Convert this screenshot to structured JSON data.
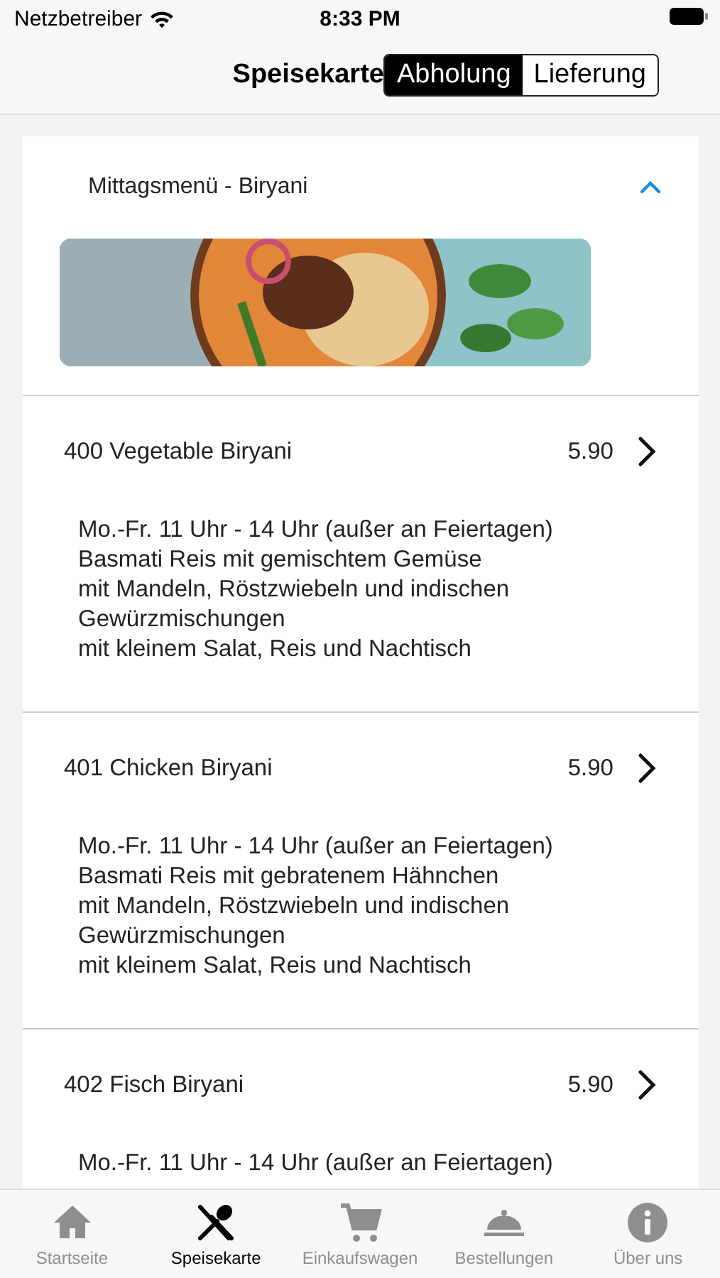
{
  "status_bar": {
    "carrier": "Netzbetreiber",
    "time": "8:33 PM"
  },
  "nav": {
    "title": "Speisekarte",
    "segments": [
      {
        "label": "Abholung",
        "selected": true
      },
      {
        "label": "Lieferung",
        "selected": false
      }
    ]
  },
  "section": {
    "title": "Mittagsmenü - Biryani",
    "expanded": true
  },
  "items": [
    {
      "name": "400 Vegetable Biryani",
      "price": "5.90",
      "description": "Mo.-Fr. 11 Uhr - 14 Uhr (außer an Feiertagen)\nBasmati Reis mit gemischtem Gemüse\nmit Mandeln, Röstzwiebeln und indischen\nGewürzmischungen\nmit kleinem Salat, Reis und Nachtisch"
    },
    {
      "name": "401 Chicken Biryani",
      "price": "5.90",
      "description": "Mo.-Fr. 11 Uhr - 14 Uhr (außer an Feiertagen)\nBasmati Reis mit gebratenem Hähnchen\nmit Mandeln, Röstzwiebeln und indischen\nGewürzmischungen\nmit kleinem Salat, Reis und Nachtisch"
    },
    {
      "name": "402 Fisch Biryani",
      "price": "5.90",
      "description": "Mo.-Fr. 11 Uhr - 14 Uhr (außer an Feiertagen)"
    }
  ],
  "tab_bar": [
    {
      "kind": "home",
      "label": "Startseite",
      "selected": false
    },
    {
      "kind": "menu",
      "label": "Speisekarte",
      "selected": true
    },
    {
      "kind": "cart",
      "label": "Einkaufswagen",
      "selected": false
    },
    {
      "kind": "orders",
      "label": "Bestellungen",
      "selected": false
    },
    {
      "kind": "info",
      "label": "Über uns",
      "selected": false
    }
  ]
}
